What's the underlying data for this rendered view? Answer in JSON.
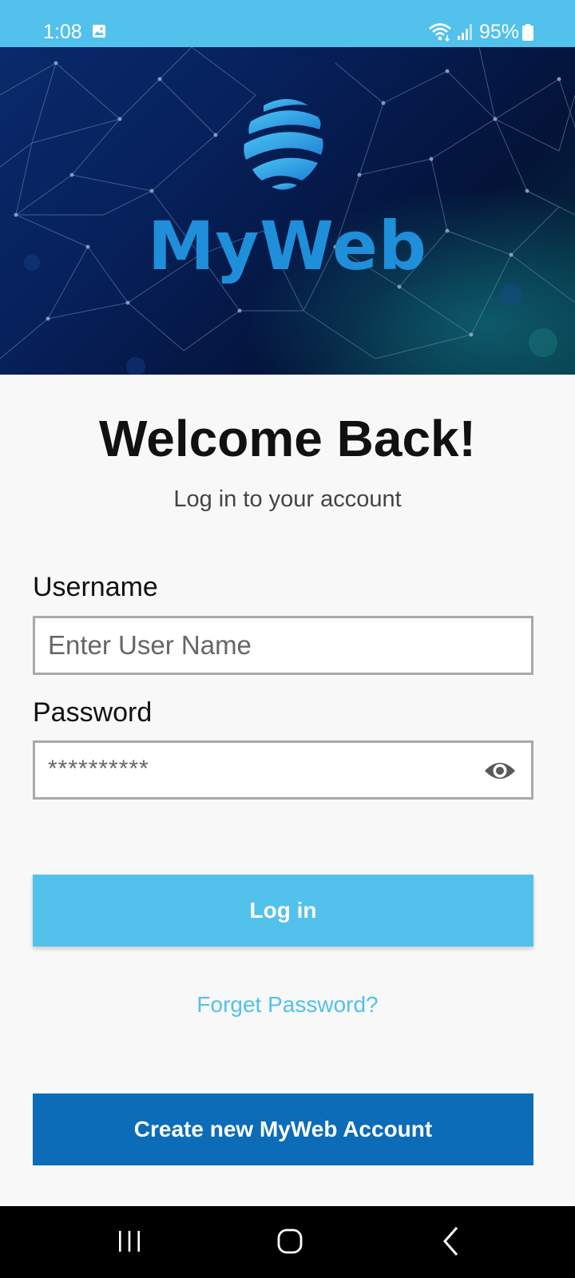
{
  "status_bar": {
    "time": "1:08",
    "battery": "95%",
    "icons": [
      "image-icon",
      "wifi-icon",
      "signal-icon",
      "battery-icon"
    ]
  },
  "hero": {
    "brand": "MyWeb",
    "icons": [
      "globe-logo-icon"
    ]
  },
  "welcome": {
    "title": "Welcome Back!",
    "subtitle": "Log in to your account"
  },
  "form": {
    "username_label": "Username",
    "username_placeholder": "Enter User Name",
    "password_label": "Password",
    "password_value": "**********",
    "password_toggle_icon": "eye-icon"
  },
  "actions": {
    "login_label": "Log in",
    "forgot_label": "Forget Password?",
    "create_label": "Create new MyWeb Account"
  },
  "nav_bar": {
    "icons": [
      "recents-icon",
      "home-icon",
      "back-icon"
    ]
  },
  "colors": {
    "accent": "#52c1ec",
    "primary_dark": "#0c6cb7",
    "brand_text": "#1e8fd8"
  }
}
